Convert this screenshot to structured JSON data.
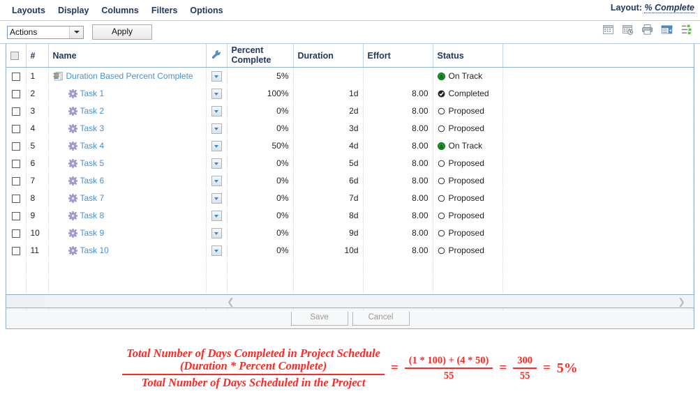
{
  "menu": {
    "items": [
      "Layouts",
      "Display",
      "Columns",
      "Filters",
      "Options"
    ],
    "layout_prefix": "Layout:",
    "layout_value": "% Complete"
  },
  "toolbar": {
    "action_select_value": "Actions",
    "apply_label": "Apply",
    "icons": [
      "grid-export-icon",
      "grid-schedule-icon",
      "print-icon",
      "grid-columns-icon",
      "outline-list-icon"
    ]
  },
  "grid": {
    "columns": [
      {
        "key": "check",
        "label": ""
      },
      {
        "key": "index",
        "label": "#"
      },
      {
        "key": "name",
        "label": "Name"
      },
      {
        "key": "tools",
        "label": ""
      },
      {
        "key": "percent",
        "label": "Percent\nComplete"
      },
      {
        "key": "duration",
        "label": "Duration"
      },
      {
        "key": "effort",
        "label": "Effort"
      },
      {
        "key": "status",
        "label": "Status"
      },
      {
        "key": "spare",
        "label": ""
      }
    ],
    "header_percent_line1": "Percent",
    "header_percent_line2": "Complete",
    "header_duration": "Duration",
    "header_effort": "Effort",
    "header_status": "Status",
    "header_name": "Name",
    "header_index": "#",
    "rows": [
      {
        "index": "1",
        "name": "Duration Based Percent Complete",
        "icon": "project-icon",
        "percent": "5%",
        "duration": "",
        "effort": "",
        "status": "On Track",
        "status_icon": "on-track-icon",
        "indent": false
      },
      {
        "index": "2",
        "name": "Task 1",
        "icon": "task-gear-icon",
        "percent": "100%",
        "duration": "1d",
        "effort": "8.00",
        "status": "Completed",
        "status_icon": "completed-icon",
        "indent": true
      },
      {
        "index": "3",
        "name": "Task 2",
        "icon": "task-gear-icon",
        "percent": "0%",
        "duration": "2d",
        "effort": "8.00",
        "status": "Proposed",
        "status_icon": "proposed-icon",
        "indent": true
      },
      {
        "index": "4",
        "name": "Task 3",
        "icon": "task-gear-icon",
        "percent": "0%",
        "duration": "3d",
        "effort": "8.00",
        "status": "Proposed",
        "status_icon": "proposed-icon",
        "indent": true
      },
      {
        "index": "5",
        "name": "Task 4",
        "icon": "task-gear-icon",
        "percent": "50%",
        "duration": "4d",
        "effort": "8.00",
        "status": "On Track",
        "status_icon": "on-track-icon",
        "indent": true
      },
      {
        "index": "6",
        "name": "Task 5",
        "icon": "task-gear-icon",
        "percent": "0%",
        "duration": "5d",
        "effort": "8.00",
        "status": "Proposed",
        "status_icon": "proposed-icon",
        "indent": true
      },
      {
        "index": "7",
        "name": "Task 6",
        "icon": "task-gear-icon",
        "percent": "0%",
        "duration": "6d",
        "effort": "8.00",
        "status": "Proposed",
        "status_icon": "proposed-icon",
        "indent": true
      },
      {
        "index": "8",
        "name": "Task 7",
        "icon": "task-gear-icon",
        "percent": "0%",
        "duration": "7d",
        "effort": "8.00",
        "status": "Proposed",
        "status_icon": "proposed-icon",
        "indent": true
      },
      {
        "index": "9",
        "name": "Task 8",
        "icon": "task-gear-icon",
        "percent": "0%",
        "duration": "8d",
        "effort": "8.00",
        "status": "Proposed",
        "status_icon": "proposed-icon",
        "indent": true
      },
      {
        "index": "10",
        "name": "Task 9",
        "icon": "task-gear-icon",
        "percent": "0%",
        "duration": "9d",
        "effort": "8.00",
        "status": "Proposed",
        "status_icon": "proposed-icon",
        "indent": true
      },
      {
        "index": "11",
        "name": "Task 10",
        "icon": "task-gear-icon",
        "percent": "0%",
        "duration": "10d",
        "effort": "8.00",
        "status": "Proposed",
        "status_icon": "proposed-icon",
        "indent": true
      }
    ]
  },
  "footer": {
    "save_label": "Save",
    "cancel_label": "Cancel"
  },
  "formula": {
    "numerator_line1": "Total Number of Days Completed in Project Schedule",
    "numerator_line2": "(Duration * Percent Complete)",
    "denominator": "Total Number of Days Scheduled in the Project",
    "equals1": "=",
    "frac2_top": "(1 * 100) + (4 * 50)",
    "frac2_bottom": "55",
    "equals2": "=",
    "frac3_top": "300",
    "frac3_bottom": "55",
    "equals3": "=",
    "result": "5%"
  },
  "colors": {
    "accent_blue": "#1f3864",
    "link_blue": "#4a8fd0",
    "row_separator_green": "#7fe08c",
    "formula_red": "#fc2a26",
    "status_ontrack_green": "#1a9e28"
  }
}
